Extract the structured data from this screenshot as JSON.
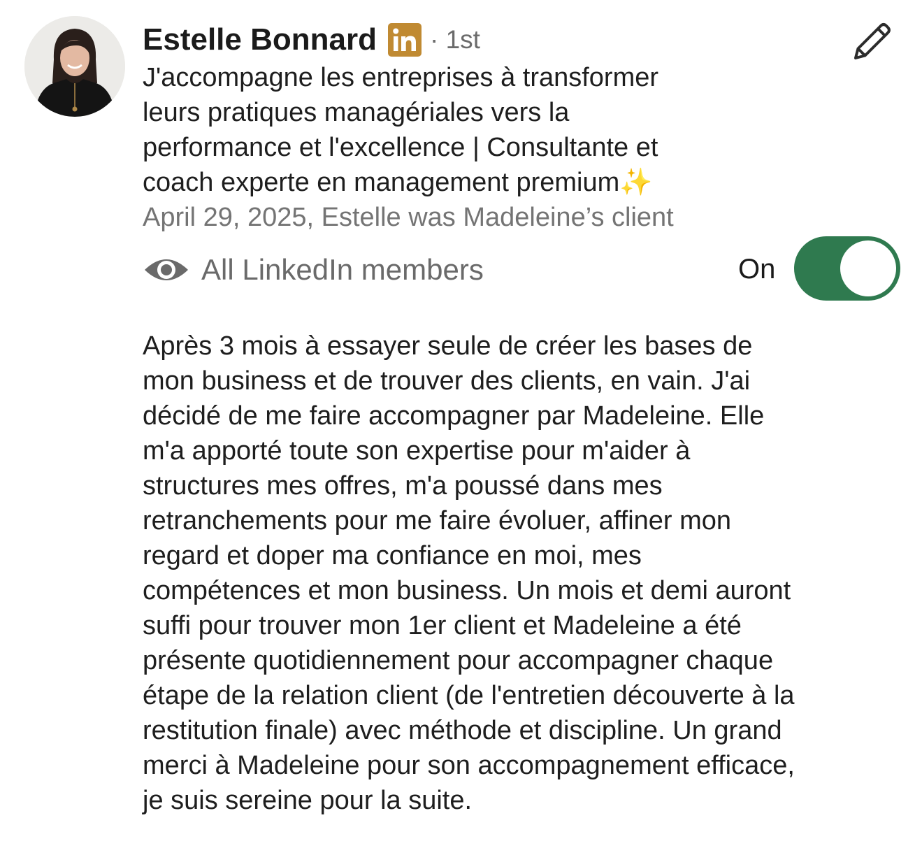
{
  "recommendation": {
    "author_name": "Estelle Bonnard",
    "connection_degree": "· 1st",
    "headline": "J'accompagne les entreprises à transformer\nleurs pratiques managériales vers la\nperformance et l'excellence | Consultante et\ncoach experte en management premium✨",
    "meta": "April 29, 2025, Estelle was Madeleine’s client",
    "visibility_label": "All LinkedIn members",
    "toggle_label": "On",
    "toggle_state": "on",
    "body": "Après 3 mois à essayer seule de créer les bases de\nmon business et de trouver des clients, en vain. J'ai\ndécidé de me faire accompagner par Madeleine. Elle\nm'a apporté toute son expertise pour m'aider à\nstructures mes offres, m'a poussé dans mes\nretranchements pour me faire évoluer, affiner mon\nregard et doper ma confiance en moi, mes\ncompétences et mon business. Un mois et demi auront\nsuffi pour trouver mon 1er client et Madeleine a été\nprésente quotidiennement pour accompagner chaque\nétape de la relation client (de l'entretien découverte à la\nrestitution finale) avec méthode et discipline. Un grand\nmerci à Madeleine pour son accompagnement efficace,\nje suis sereine pour la suite."
  },
  "icons": {
    "linkedin_badge": "linkedin-icon",
    "edit": "pencil-icon",
    "visibility": "eye-icon"
  },
  "colors": {
    "linkedin_badge": "#c08a32",
    "toggle_on": "#2f7a4f",
    "secondary_text": "#747474"
  }
}
